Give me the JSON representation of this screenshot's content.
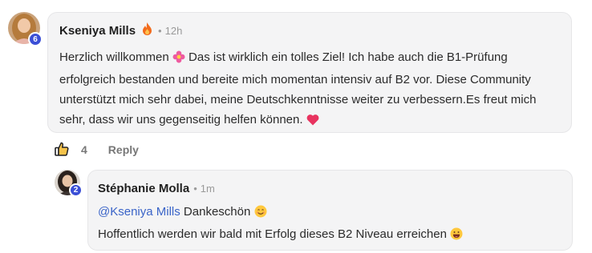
{
  "comment": {
    "author": "Kseniya Mills",
    "author_badge_icon": "fire-icon",
    "timestamp": "12h",
    "separator": "•",
    "level": "6",
    "body_part1": "Herzlich willkommen ",
    "body_emoji1": "flower-emoji",
    "body_part2": "  Das ist wirklich ein tolles Ziel! Ich habe auch die B1-Prüfung erfolgreich bestanden und bereite mich momentan intensiv auf B2 vor. Diese Community unterstützt mich sehr dabei, meine Deutschkenntnisse weiter zu verbessern.Es freut mich sehr, dass wir uns gegenseitig helfen können. ",
    "body_emoji2": "heart-emoji",
    "like_count": "4",
    "reply_label": "Reply"
  },
  "reply": {
    "author": "Stéphanie Molla",
    "timestamp": "1m",
    "separator": "•",
    "level": "2",
    "mention": "@Kseniya Mills",
    "line1_text": " Dankeschön ",
    "line1_emoji": "smile-emoji",
    "line2_text": "Hoffentlich werden wir bald mit Erfolg dieses B2 Niveau erreichen ",
    "line2_emoji": "grin-emoji"
  },
  "colors": {
    "level_badge": "#3b4fd6",
    "bubble_bg": "#f4f4f5",
    "mention": "#3a64c8"
  }
}
